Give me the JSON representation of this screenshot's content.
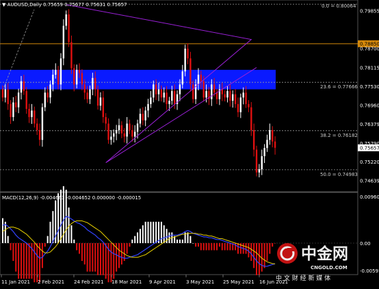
{
  "header": {
    "symbol_line": "▼ AUDUSD,Daily  0.75659 0.75677 0.75631 0.75657"
  },
  "macd": {
    "label": "MACD(12,26,9) -0.004663 -0.004652 0.000000 -0.000015"
  },
  "fibo_labels": [
    "0.0 = 0.80064",
    "23.6 = 0.77666",
    "38.2 = 0.76182",
    "50.0 = 0.74983"
  ],
  "price_axis": [
    "0.79855",
    "0.78850",
    "0.78700",
    "0.78115",
    "0.77530",
    "0.76960",
    "0.76379",
    "0.75790",
    "0.75657",
    "0.75220",
    "0.74639"
  ],
  "macd_axis": [
    "0.009604",
    "0.00",
    "-0.005915"
  ],
  "date_axis": [
    "11 Jan 2021",
    "2 Feb 2021",
    "24 Feb 2021",
    "18 Mar 2021",
    "9 Apr 2021",
    "3 May 2021",
    "25 May 2021",
    "16 Jun 2021"
  ],
  "watermark": {
    "title": "中金网",
    "url": "CNGOLD.COM",
    "subtitle": "中 文 财 经 新 媒 体"
  },
  "colors": {
    "background": "#000000",
    "bull": "#ffffff",
    "bear": "#e01010",
    "fibo": "#9a9a9a",
    "resistance": "#d4880a",
    "zone": "#0a1aff",
    "triangle": "#9a20d8",
    "macd_main": "#3344ff",
    "macd_signal": "#e8d000"
  },
  "chart_data": {
    "type": "candlestick",
    "title": "AUDUSD,Daily",
    "ylim": [
      0.7435,
      0.8015
    ],
    "last_price": 0.75657,
    "resistance_price": 0.7885,
    "fibonacci": [
      {
        "level": "0.0",
        "price": 0.80064
      },
      {
        "level": "23.6",
        "price": 0.77666
      },
      {
        "level": "38.2",
        "price": 0.76182
      },
      {
        "level": "50.0",
        "price": 0.74983
      }
    ],
    "zone": [
      0.7745,
      0.7805
    ],
    "triangle": [
      [
        24,
        0.8005
      ],
      [
        94,
        0.7898
      ],
      [
        39,
        0.752
      ],
      [
        96,
        0.7812
      ]
    ],
    "closes": [
      0.772,
      0.7745,
      0.77,
      0.766,
      0.7705,
      0.769,
      0.7735,
      0.777,
      0.774,
      0.7685,
      0.766,
      0.768,
      0.764,
      0.762,
      0.759,
      0.769,
      0.7735,
      0.772,
      0.776,
      0.779,
      0.7805,
      0.776,
      0.784,
      0.794,
      0.7975,
      0.789,
      0.781,
      0.776,
      0.7805,
      0.7795,
      0.776,
      0.7735,
      0.7715,
      0.7745,
      0.778,
      0.7745,
      0.7695,
      0.772,
      0.766,
      0.764,
      0.759,
      0.76,
      0.761,
      0.762,
      0.7635,
      0.761,
      0.76,
      0.764,
      0.762,
      0.76,
      0.7615,
      0.764,
      0.767,
      0.765,
      0.768,
      0.77,
      0.772,
      0.776,
      0.773,
      0.7745,
      0.772,
      0.7735,
      0.77,
      0.771,
      0.774,
      0.77,
      0.773,
      0.776,
      0.78,
      0.787,
      0.784,
      0.776,
      0.7715,
      0.776,
      0.779,
      0.777,
      0.772,
      0.774,
      0.7715,
      0.776,
      0.7735,
      0.7715,
      0.7745,
      0.773,
      0.772,
      0.774,
      0.771,
      0.773,
      0.77,
      0.7675,
      0.772,
      0.7735,
      0.77,
      0.769,
      0.762,
      0.756,
      0.749,
      0.75,
      0.754,
      0.7565,
      0.759,
      0.762,
      0.7585,
      0.75657
    ],
    "macd": [
      0.004,
      0.0042,
      0.0038,
      0.0032,
      0.0026,
      0.0018,
      0.0012,
      0.0008,
      0.0004,
      0.0,
      -0.0006,
      -0.0012,
      -0.002,
      -0.0028,
      -0.0034,
      -0.0032,
      -0.0024,
      -0.0018,
      -0.0008,
      0.0004,
      0.0016,
      0.0028,
      0.004,
      0.0052,
      0.006,
      0.0058,
      0.0054,
      0.005,
      0.0046,
      0.0044,
      0.004,
      0.0036,
      0.003,
      0.0026,
      0.0022,
      0.0018,
      0.0012,
      0.0008,
      0.0002,
      -0.0006,
      -0.0014,
      -0.002,
      -0.0024,
      -0.0026,
      -0.003,
      -0.0032,
      -0.0034,
      -0.0034,
      -0.0032,
      -0.003,
      -0.0028,
      -0.0026,
      -0.0022,
      -0.0018,
      -0.0014,
      -0.001,
      -0.0006,
      -0.0002,
      0.0002,
      0.0006,
      0.001,
      0.0012,
      0.0014,
      0.0016,
      0.0018,
      0.0018,
      0.0018,
      0.002,
      0.0022,
      0.0026,
      0.0028,
      0.0026,
      0.0022,
      0.002,
      0.0018,
      0.0016,
      0.0014,
      0.0014,
      0.0012,
      0.0012,
      0.001,
      0.0008,
      0.0008,
      0.0006,
      0.0004,
      0.0002,
      0.0,
      -0.0002,
      -0.0004,
      -0.0008,
      -0.001,
      -0.0012,
      -0.0014,
      -0.0018,
      -0.0024,
      -0.0032,
      -0.004,
      -0.0046,
      -0.005,
      -0.0052,
      -0.0052,
      -0.005,
      -0.0048,
      -0.004663
    ],
    "signal": [
      0.0026,
      0.003,
      0.0034,
      0.0036,
      0.0036,
      0.0034,
      0.0032,
      0.0028,
      0.0024,
      0.002,
      0.0014,
      0.0008,
      0.0002,
      -0.0006,
      -0.0012,
      -0.0018,
      -0.0022,
      -0.0022,
      -0.002,
      -0.0014,
      -0.0008,
      0.0,
      0.001,
      0.002,
      0.003,
      0.0038,
      0.0044,
      0.0048,
      0.005,
      0.005,
      0.005,
      0.0048,
      0.0046,
      0.0042,
      0.0038,
      0.0034,
      0.003,
      0.0026,
      0.002,
      0.0014,
      0.0008,
      0.0002,
      -0.0004,
      -0.001,
      -0.0016,
      -0.002,
      -0.0024,
      -0.0028,
      -0.003,
      -0.0032,
      -0.0032,
      -0.0032,
      -0.003,
      -0.0028,
      -0.0026,
      -0.0022,
      -0.0018,
      -0.0014,
      -0.001,
      -0.0006,
      -0.0002,
      0.0002,
      0.0006,
      0.001,
      0.0012,
      0.0014,
      0.0016,
      0.0018,
      0.002,
      0.002,
      0.0022,
      0.0022,
      0.0022,
      0.0022,
      0.002,
      0.002,
      0.0018,
      0.0018,
      0.0016,
      0.0016,
      0.0014,
      0.0012,
      0.001,
      0.001,
      0.0008,
      0.0006,
      0.0004,
      0.0002,
      0.0,
      -0.0002,
      -0.0004,
      -0.0006,
      -0.0008,
      -0.001,
      -0.0014,
      -0.0018,
      -0.0022,
      -0.0028,
      -0.0034,
      -0.0038,
      -0.0042,
      -0.0044,
      -0.0046,
      -0.004652
    ]
  }
}
